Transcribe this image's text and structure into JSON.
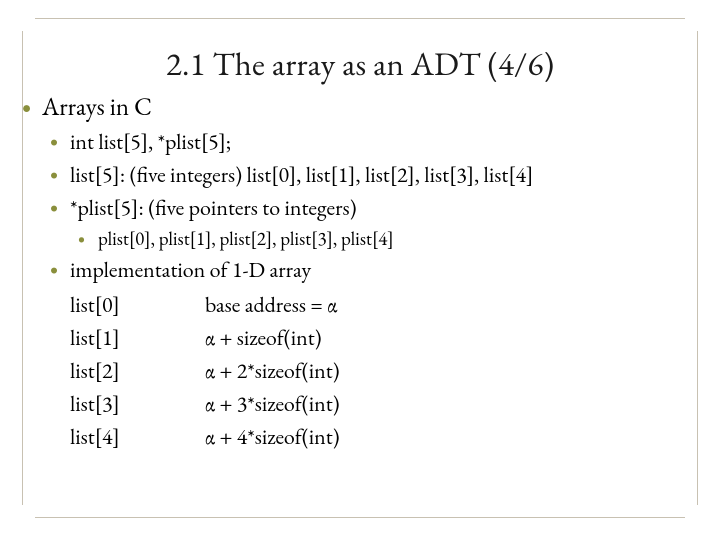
{
  "title": "2.1 The array as an ADT (4/6)",
  "bullet_lvl1": "Arrays in C",
  "bullets_lvl2": {
    "b0": "int list[5], *plist[5];",
    "b1": "list[5]: (five integers) list[0], list[1], list[2], list[3], list[4]",
    "b2": "*plist[5]: (five pointers to integers)",
    "b3_header": "implementation of 1-D array"
  },
  "bullets_lvl3": {
    "p0": "plist[0], plist[1], plist[2], plist[3], plist[4]"
  },
  "impl": [
    {
      "idx": "list[0]",
      "addr": "base address = α"
    },
    {
      "idx": "list[1]",
      "addr": "α + sizeof(int)"
    },
    {
      "idx": "list[2]",
      "addr": "α + 2*sizeof(int)"
    },
    {
      "idx": "list[3]",
      "addr": "α + 3*sizeof(int)"
    },
    {
      "idx": "list[4]",
      "addr": "α + 4*sizeof(int)"
    }
  ]
}
